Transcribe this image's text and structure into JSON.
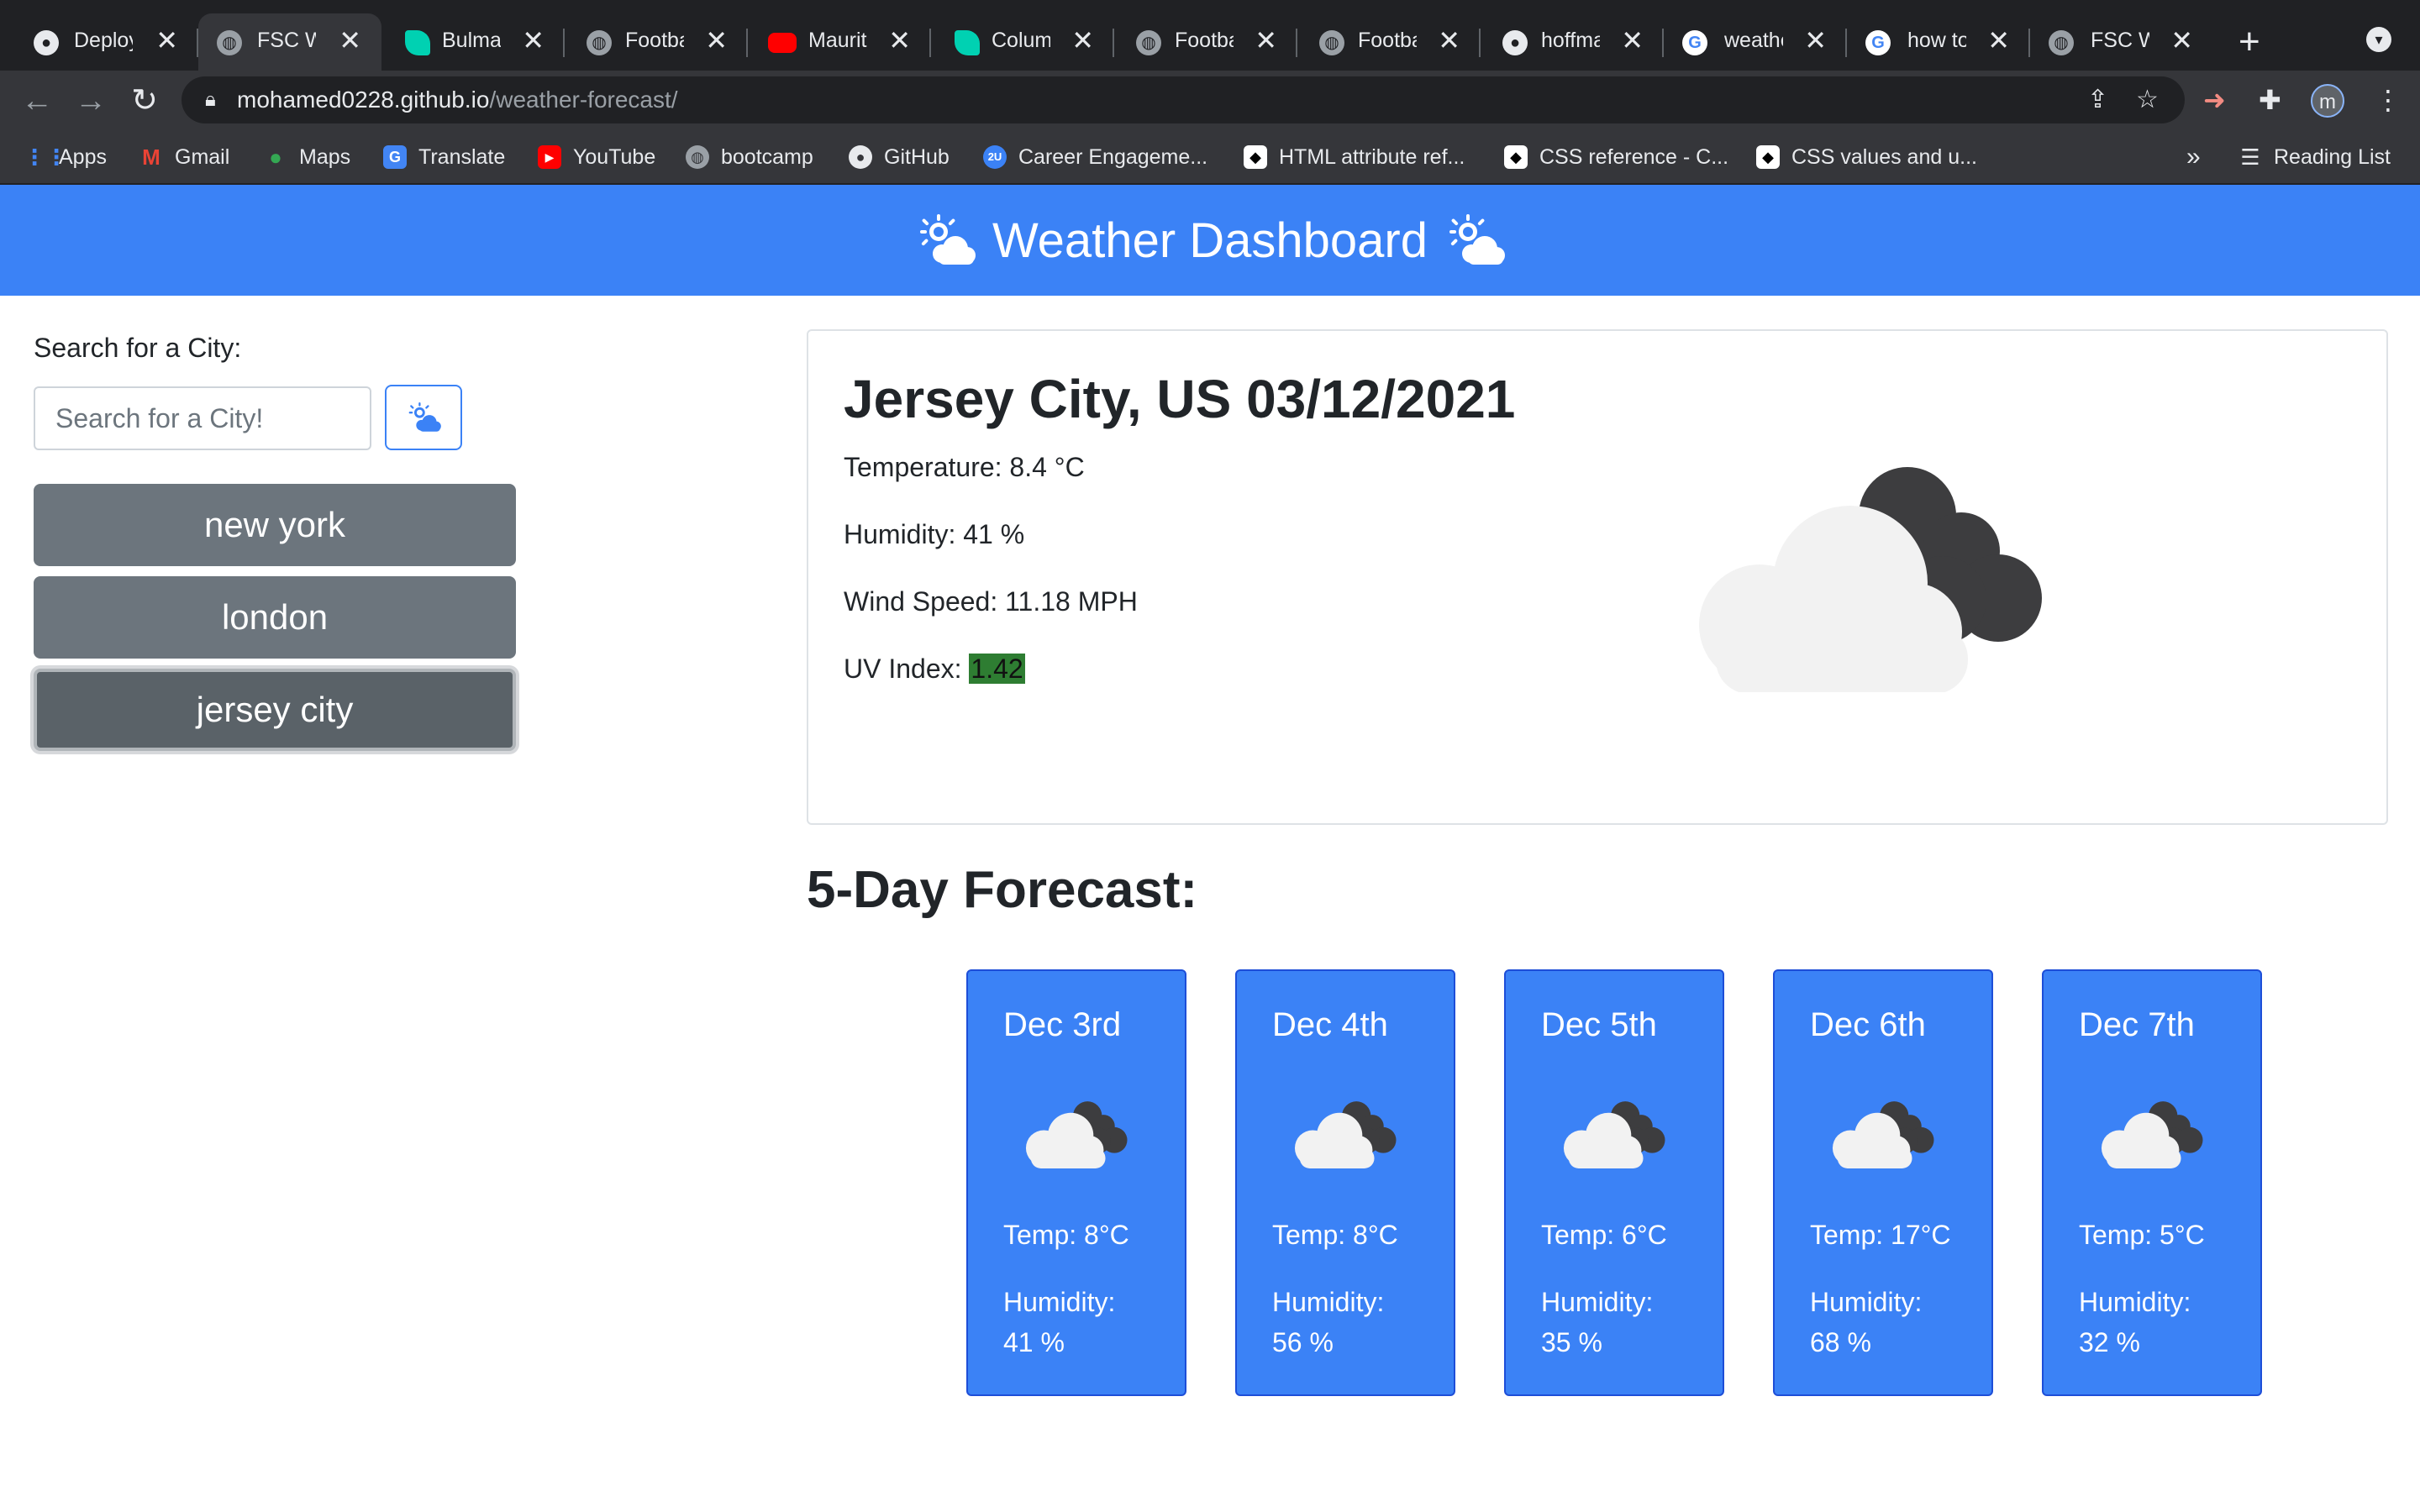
{
  "browser": {
    "tabs": [
      {
        "label": "Deploym",
        "icon": "github-icon"
      },
      {
        "label": "FSC We",
        "icon": "globe-icon",
        "active": true
      },
      {
        "label": "Bulma: I",
        "icon": "bulma-icon"
      },
      {
        "label": "Football",
        "icon": "globe-icon"
      },
      {
        "label": "Maurita",
        "icon": "youtube-icon"
      },
      {
        "label": "Column",
        "icon": "bulma-icon"
      },
      {
        "label": "Football",
        "icon": "globe-icon"
      },
      {
        "label": "Football",
        "icon": "globe-icon"
      },
      {
        "label": "hoffmar",
        "icon": "github-icon"
      },
      {
        "label": "weather",
        "icon": "google-icon"
      },
      {
        "label": "how to l",
        "icon": "google-icon"
      },
      {
        "label": "FSC We",
        "icon": "globe-icon"
      }
    ],
    "close_glyph": "✕",
    "new_tab_glyph": "+",
    "url_host": "mohamed0228.github.io",
    "url_path": "/weather-forecast/",
    "profile_initial": "m",
    "bookmarks": [
      {
        "label": "Apps",
        "color": "#4285f4"
      },
      {
        "label": "Gmail",
        "color": "#ea4335"
      },
      {
        "label": "Maps",
        "color": "#34a853"
      },
      {
        "label": "Translate",
        "color": "#4285f4"
      },
      {
        "label": "YouTube",
        "color": "#ff0000"
      },
      {
        "label": "bootcamp",
        "color": "#9aa0a6"
      },
      {
        "label": "GitHub",
        "color": "#e8eaed"
      },
      {
        "label": "Career Engageme...",
        "color": "#3b82f6"
      },
      {
        "label": "HTML attribute ref...",
        "color": "#ffffff"
      },
      {
        "label": "CSS reference - C...",
        "color": "#ffffff"
      },
      {
        "label": "CSS values and u...",
        "color": "#ffffff"
      }
    ],
    "bookmarks_overflow": "»",
    "reading_list": "Reading List"
  },
  "app": {
    "title": "Weather Dashboard",
    "accent_color": "#3b82f6",
    "search": {
      "label": "Search for a City:",
      "placeholder": "Search for a City!",
      "button_icon": "cloud-sun-icon"
    },
    "history": [
      "new york",
      "london",
      "jersey city"
    ],
    "active_city_index": 2,
    "current": {
      "title": "Jersey City, US 03/12/2021",
      "temperature": "Temperature: 8.4 °C",
      "humidity": "Humidity: 41 %",
      "wind": "Wind Speed: 11.18 MPH",
      "uv_label": "UV Index: ",
      "uv_value": "1.42",
      "uv_color": "#2e7d32",
      "icon": "cloud-moon-icon"
    },
    "forecast_title": "5-Day Forecast:",
    "forecast": [
      {
        "date": "Dec 3rd",
        "temp": "Temp: 8°C",
        "humidity_label": "Humidity:",
        "humidity": "41 %"
      },
      {
        "date": "Dec 4th",
        "temp": "Temp: 8°C",
        "humidity_label": "Humidity:",
        "humidity": "56 %"
      },
      {
        "date": "Dec 5th",
        "temp": "Temp: 6°C",
        "humidity_label": "Humidity:",
        "humidity": "35 %"
      },
      {
        "date": "Dec 6th",
        "temp": "Temp: 17°C",
        "humidity_label": "Humidity:",
        "humidity": "68 %"
      },
      {
        "date": "Dec 7th",
        "temp": "Temp: 5°C",
        "humidity_label": "Humidity:",
        "humidity": "32 %"
      }
    ]
  }
}
